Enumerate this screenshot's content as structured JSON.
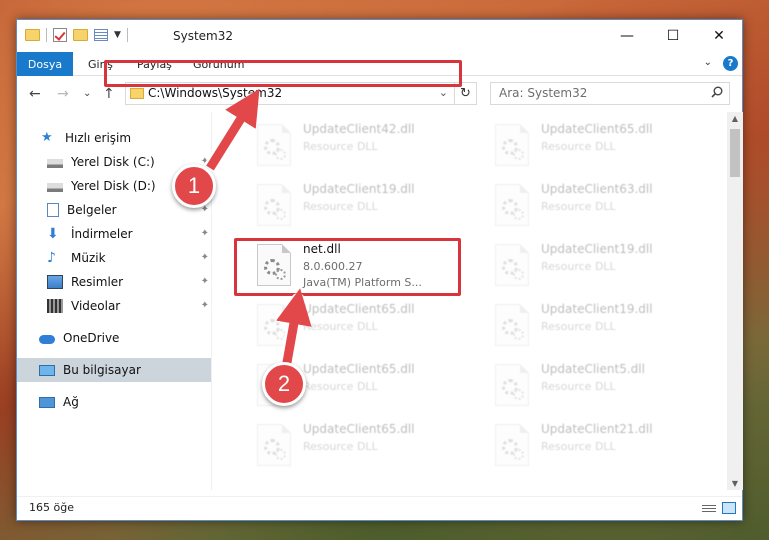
{
  "window": {
    "title": "System32",
    "minimize": "—",
    "maximize": "☐",
    "close": "✕"
  },
  "ribbon": {
    "tabs": [
      "Dosya",
      "Giriş",
      "Paylaş",
      "Görünüm"
    ],
    "expand": "⌄",
    "help": "?"
  },
  "nav": {
    "back": "←",
    "forward": "→",
    "recent": "⌄",
    "up": "↑",
    "address": "C:\\Windows\\System32",
    "address_dropdown": "⌄",
    "refresh": "↻",
    "search_placeholder": "Ara: System32"
  },
  "sidebar": {
    "items": [
      {
        "label": "Hızlı erişim",
        "icon": "star-icon",
        "pinned": false
      },
      {
        "label": "Yerel Disk (C:)",
        "icon": "drive-icon",
        "pinned": true
      },
      {
        "label": "Yerel Disk (D:)",
        "icon": "drive-icon",
        "pinned": true
      },
      {
        "label": "Belgeler",
        "icon": "documents-icon",
        "pinned": true
      },
      {
        "label": "İndirmeler",
        "icon": "download-icon",
        "pinned": true
      },
      {
        "label": "Müzik",
        "icon": "music-icon",
        "pinned": true
      },
      {
        "label": "Resimler",
        "icon": "pictures-icon",
        "pinned": true
      },
      {
        "label": "Videolar",
        "icon": "video-icon",
        "pinned": true
      },
      {
        "label": "OneDrive",
        "icon": "cloud-icon",
        "pinned": false
      },
      {
        "label": "Bu bilgisayar",
        "icon": "computer-icon",
        "pinned": false
      },
      {
        "label": "Ağ",
        "icon": "network-icon",
        "pinned": false
      }
    ],
    "pin_glyph": "📌"
  },
  "files": [
    {
      "name": "UpdateClient42.dll",
      "line2": "Resource DLL",
      "line3": ""
    },
    {
      "name": "UpdateClient65.dll",
      "line2": "Resource DLL",
      "line3": ""
    },
    {
      "name": "UpdateClient19.dll",
      "line2": "Resource DLL",
      "line3": ""
    },
    {
      "name": "UpdateClient63.dll",
      "line2": "Resource DLL",
      "line3": ""
    },
    {
      "name": "net.dll",
      "line2": "8.0.600.27",
      "line3": "Java(TM) Platform S..."
    },
    {
      "name": "UpdateClient19.dll",
      "line2": "Resource DLL",
      "line3": ""
    },
    {
      "name": "UpdateClient65.dll",
      "line2": "Resource DLL",
      "line3": ""
    },
    {
      "name": "UpdateClient19.dll",
      "line2": "Resource DLL",
      "line3": ""
    },
    {
      "name": "UpdateClient65.dll",
      "line2": "Resource DLL",
      "line3": ""
    },
    {
      "name": "UpdateClient5.dll",
      "line2": "Resource DLL",
      "line3": ""
    },
    {
      "name": "UpdateClient65.dll",
      "line2": "Resource DLL",
      "line3": ""
    },
    {
      "name": "UpdateClient21.dll",
      "line2": "Resource DLL",
      "line3": ""
    }
  ],
  "status": {
    "count": "165 öğe"
  },
  "annotations": {
    "step1": "1",
    "step2": "2",
    "color": "#e2474a"
  }
}
